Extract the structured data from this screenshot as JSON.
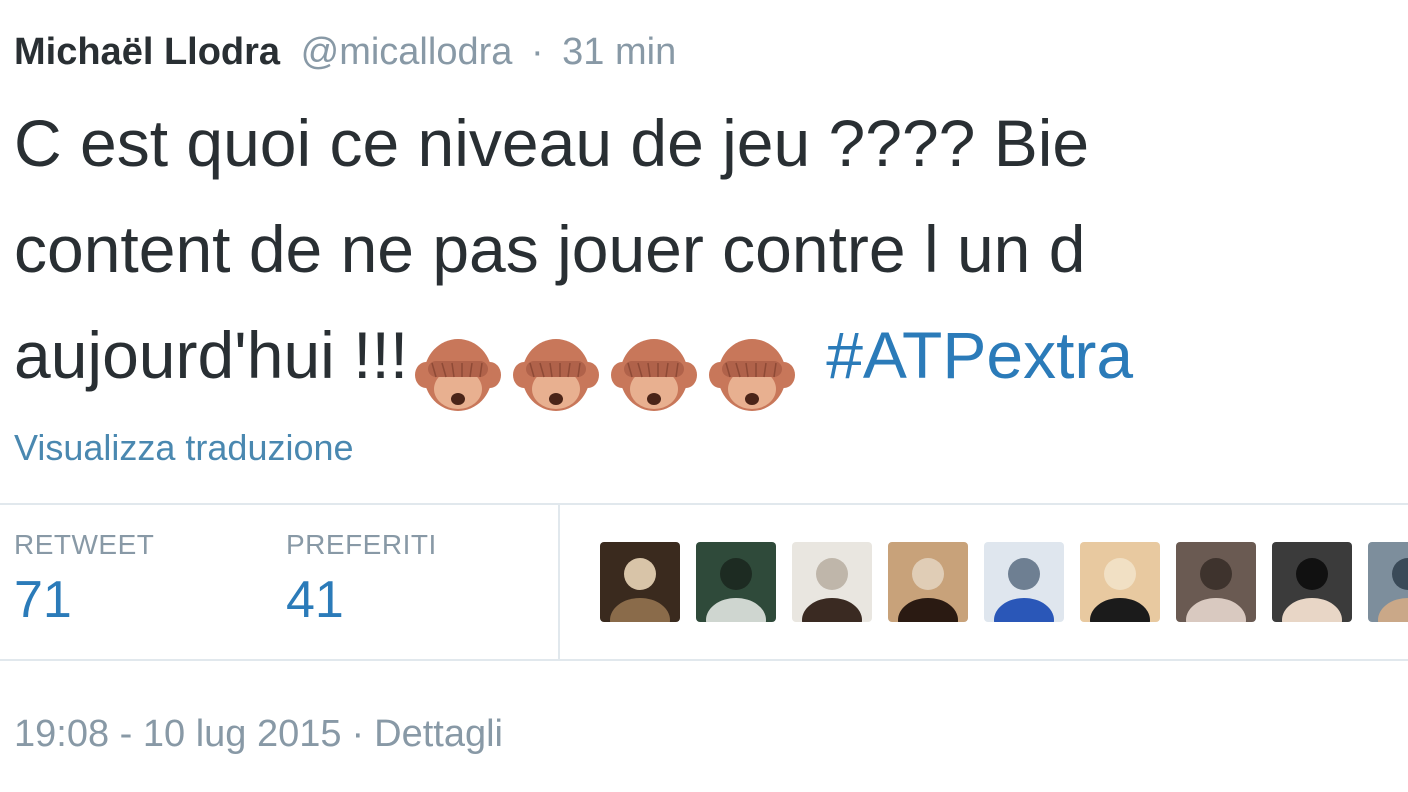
{
  "tweet": {
    "author_name": "Michaël Llodra",
    "handle": "@micallodra",
    "separator": "·",
    "time_ago": "31 min",
    "text_lines": [
      "C est quoi ce niveau de jeu ???? Bie",
      "content de ne pas jouer contre l un d",
      "aujourd'hui !!!"
    ],
    "emoji": [
      "see-no-evil-monkey-icon",
      "see-no-evil-monkey-icon",
      "see-no-evil-monkey-icon",
      "see-no-evil-monkey-icon"
    ],
    "hashtag": "#ATPextra",
    "translate_label": "Visualizza traduzione"
  },
  "stats": {
    "retweet_label": "RETWEET",
    "retweet_count": "71",
    "favorites_label": "PREFERITI",
    "favorites_count": "41"
  },
  "avatars": [
    {
      "name": "avatar-1",
      "colors": [
        "#3a2a1e",
        "#8a6b4a",
        "#d8c4a8"
      ]
    },
    {
      "name": "avatar-2",
      "colors": [
        "#2f4a3a",
        "#cfd6d0",
        "#1d2b22"
      ]
    },
    {
      "name": "avatar-3",
      "colors": [
        "#e9e6e0",
        "#3a2a22",
        "#bfb6aa"
      ]
    },
    {
      "name": "avatar-4",
      "colors": [
        "#c8a27a",
        "#2a1a12",
        "#e0cdb6"
      ]
    },
    {
      "name": "avatar-5",
      "colors": [
        "#dfe6ee",
        "#2a57b8",
        "#6e7f92"
      ]
    },
    {
      "name": "avatar-6",
      "colors": [
        "#e8c9a0",
        "#1b1b1b",
        "#f1e0c4"
      ]
    },
    {
      "name": "avatar-7",
      "colors": [
        "#6a5a52",
        "#d9c9c0",
        "#3e332d"
      ]
    },
    {
      "name": "avatar-8",
      "colors": [
        "#3b3b3b",
        "#e8d6c6",
        "#111111"
      ]
    },
    {
      "name": "avatar-9",
      "colors": [
        "#7d8e9c",
        "#caa888",
        "#3a4a58"
      ]
    }
  ],
  "footer": {
    "timestamp": "19:08 - 10 lug 2015",
    "separator": "·",
    "details_label": "Dettagli"
  },
  "colors": {
    "link": "#2b7bb9",
    "muted": "#8899a6",
    "text": "#292f33",
    "monkey": "#c8775a"
  }
}
